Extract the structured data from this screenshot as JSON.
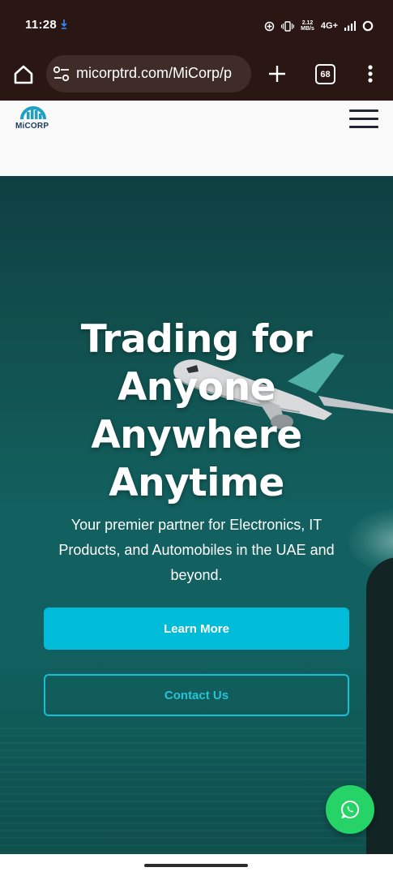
{
  "status_bar": {
    "time": "11:28",
    "speed_value": "2.12",
    "speed_unit": "MB/s",
    "network": "4G+"
  },
  "browser": {
    "url": "micorptrd.com/MiCorp/p",
    "tab_count": "68"
  },
  "site": {
    "logo_text": "MiCORP"
  },
  "hero": {
    "title_lines": [
      "Trading for",
      "Anyone",
      "Anywhere",
      "Anytime"
    ],
    "subtitle": "Your premier partner for Electronics, IT Products, and Automobiles in the UAE and beyond.",
    "learn_more_label": "Learn More",
    "contact_label": "Contact Us"
  },
  "colors": {
    "browser_bg": "#2a1713",
    "hero_teal": "#126160",
    "primary_button": "#00bcd9",
    "outline_button": "#14c0d6",
    "whatsapp": "#25d366"
  },
  "icons": {
    "home": "home-icon",
    "site_settings": "tune-icon",
    "new_tab": "plus-icon",
    "menu": "more-vert-icon",
    "hamburger": "hamburger-menu-icon",
    "whatsapp": "whatsapp-icon"
  }
}
